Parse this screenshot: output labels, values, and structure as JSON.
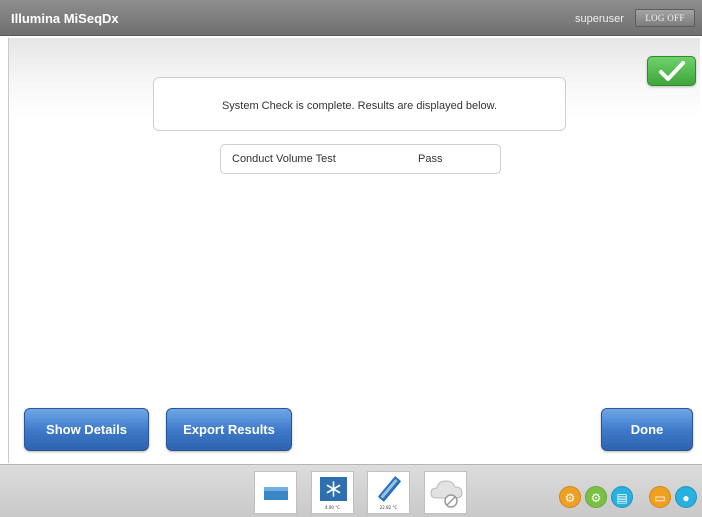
{
  "header": {
    "app_title": "Illumina MiSeqDx",
    "user": "superuser",
    "logoff_label": "LOG OFF"
  },
  "main": {
    "message": "System Check is complete. Results are displayed below.",
    "results": [
      {
        "test": "Conduct Volume Test",
        "status": "Pass"
      }
    ]
  },
  "buttons": {
    "show_details": "Show Details",
    "export_results": "Export Results",
    "done": "Done"
  },
  "status_bar": {
    "tiles": [
      {
        "icon": "flow-cell-icon"
      },
      {
        "icon": "reagent-chiller-icon",
        "temperature": "4.00 °C"
      },
      {
        "icon": "flow-cell-temperature-icon",
        "temperature": "22.82 °C"
      },
      {
        "icon": "network-disconnected-icon"
      }
    ],
    "indicators": [
      {
        "icon": "gear-icon",
        "color": "#f0a020"
      },
      {
        "icon": "gear-icon",
        "color": "#7ac143"
      },
      {
        "icon": "server-icon",
        "color": "#27b0e0"
      },
      {
        "icon": "folder-icon",
        "color": "#f0a020"
      },
      {
        "icon": "water-drop-icon",
        "color": "#27b0e0"
      }
    ]
  },
  "colors": {
    "header_bg": "#7e7e7e",
    "button_blue": "#3c78c8",
    "check_green": "#4fb64b"
  }
}
